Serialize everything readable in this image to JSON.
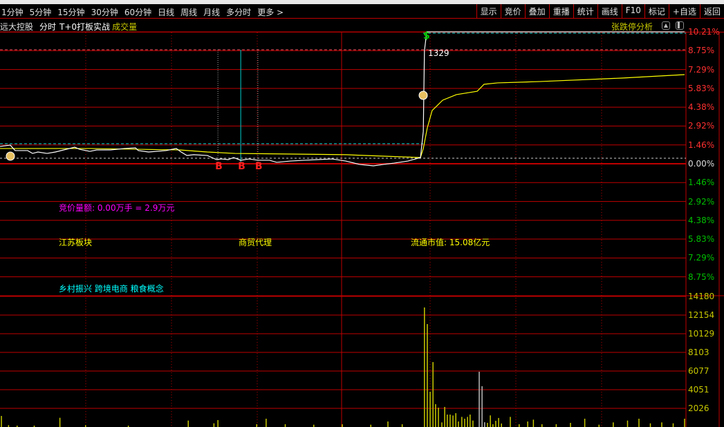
{
  "toolbar": {
    "periods": [
      "1分钟",
      "5分钟",
      "15分钟",
      "30分钟",
      "60分钟",
      "日线",
      "周线",
      "月线",
      "多分时",
      "更多 >"
    ],
    "buttons": [
      "显示",
      "竞价",
      "叠加",
      "重播",
      "统计",
      "画线",
      "F10",
      "标记",
      "+自选",
      "返回"
    ]
  },
  "subbar": {
    "stock_name": "远大控股",
    "mode": "分时",
    "strategy": "T+0打板实战",
    "indicator": "成交量",
    "analysis": "张跌停分析"
  },
  "info": {
    "auction": "竞价量额: 0.00万手 = 2.9万元",
    "region": "江苏板块",
    "industry": "商贸代理",
    "float_cap": "流通市值: 15.08亿元",
    "concepts": "乡村振兴 跨境电商 粮食概念"
  },
  "markers": {
    "buy_label": "B",
    "sell_symbol": "$",
    "spike_volume": "1329"
  },
  "colors": {
    "grid": "#c00000",
    "price": "#ffffff",
    "avg": "#ffff00",
    "up": "#ff3030",
    "down": "#00c000",
    "vol": "#c8c800"
  },
  "chart_data": {
    "type": "line",
    "price_axis_labels": [
      "10.21%",
      "8.75%",
      "7.29%",
      "5.83%",
      "4.38%",
      "2.92%",
      "1.46%",
      "0.00%",
      "1.46%",
      "2.92%",
      "4.38%",
      "5.83%",
      "7.29%",
      "8.75%"
    ],
    "price_axis_values": [
      10.21,
      8.75,
      7.29,
      5.83,
      4.38,
      2.92,
      1.46,
      0,
      -1.46,
      -2.92,
      -4.38,
      -5.83,
      -7.29,
      -8.75
    ],
    "volume_axis_labels": [
      "14180",
      "12154",
      "10129",
      "8103",
      "6077",
      "4051",
      "2026"
    ],
    "volume_axis_values": [
      14180,
      12154,
      10129,
      8103,
      6077,
      4051,
      2026
    ],
    "x_range_minutes": [
      0,
      240
    ],
    "buy_minutes": [
      76.4,
      84.4,
      90.4
    ],
    "price_pct": [
      [
        0,
        1.34
      ],
      [
        3.6,
        1.44
      ],
      [
        5.3,
        1.02
      ],
      [
        9.7,
        1.02
      ],
      [
        11.4,
        0.8
      ],
      [
        13.3,
        0.91
      ],
      [
        16.5,
        0.8
      ],
      [
        19.4,
        0.91
      ],
      [
        26.2,
        1.28
      ],
      [
        27.9,
        1.12
      ],
      [
        31.5,
        0.96
      ],
      [
        33.9,
        1.07
      ],
      [
        38.8,
        1.07
      ],
      [
        43.6,
        1.18
      ],
      [
        47.5,
        1.23
      ],
      [
        48.5,
        1.02
      ],
      [
        52.1,
        0.91
      ],
      [
        58.2,
        1.02
      ],
      [
        61.8,
        1.18
      ],
      [
        63.5,
        0.91
      ],
      [
        65.5,
        0.64
      ],
      [
        67.9,
        0.7
      ],
      [
        72.7,
        0.64
      ],
      [
        75.9,
        0.32
      ],
      [
        77.6,
        0.37
      ],
      [
        80,
        0.32
      ],
      [
        81.9,
        0.48
      ],
      [
        84.4,
        0.27
      ],
      [
        87.3,
        0.37
      ],
      [
        90.4,
        0.27
      ],
      [
        94.5,
        0.27
      ],
      [
        97,
        0.11
      ],
      [
        101.8,
        0.21
      ],
      [
        106.7,
        0.27
      ],
      [
        111.5,
        0.32
      ],
      [
        116.4,
        0.37
      ],
      [
        121.2,
        0.21
      ],
      [
        126,
        -0.05
      ],
      [
        130.9,
        -0.16
      ],
      [
        134.5,
        -0.05
      ],
      [
        138.2,
        0.05
      ],
      [
        143,
        0.21
      ],
      [
        147.4,
        0.48
      ],
      [
        148.4,
        2.51
      ],
      [
        148.8,
        8.75
      ],
      [
        149.6,
        10.21
      ],
      [
        240,
        10.21
      ]
    ],
    "avg_pct": [
      [
        0,
        1.18
      ],
      [
        31.5,
        1.18
      ],
      [
        63,
        1.07
      ],
      [
        72.7,
        0.91
      ],
      [
        82.4,
        0.8
      ],
      [
        121.2,
        0.7
      ],
      [
        147.4,
        0.48
      ],
      [
        148.4,
        1.18
      ],
      [
        149.8,
        2.78
      ],
      [
        151.5,
        4.12
      ],
      [
        155.2,
        4.92
      ],
      [
        160,
        5.35
      ],
      [
        167.3,
        5.61
      ],
      [
        169.7,
        6.15
      ],
      [
        174.5,
        6.26
      ],
      [
        189,
        6.36
      ],
      [
        218,
        6.63
      ],
      [
        240,
        6.9
      ]
    ],
    "volume": [
      [
        0.5,
        1200
      ],
      [
        3,
        200
      ],
      [
        6,
        150
      ],
      [
        12,
        150
      ],
      [
        21,
        1000
      ],
      [
        30,
        200
      ],
      [
        45,
        150
      ],
      [
        66,
        700
      ],
      [
        75,
        400
      ],
      [
        76.4,
        750
      ],
      [
        90,
        300
      ],
      [
        93.3,
        900
      ],
      [
        100,
        300
      ],
      [
        110,
        250
      ],
      [
        120,
        300
      ],
      [
        130,
        250
      ],
      [
        136,
        600
      ],
      [
        141,
        300
      ],
      [
        148.8,
        12980
      ],
      [
        149.8,
        11180
      ],
      [
        150.8,
        3830
      ],
      [
        151.8,
        7050
      ],
      [
        152.7,
        2480
      ],
      [
        153.7,
        2100
      ],
      [
        154.9,
        500
      ],
      [
        155.9,
        2180
      ],
      [
        156.8,
        1350
      ],
      [
        157.8,
        1350
      ],
      [
        158.8,
        1250
      ],
      [
        159.8,
        1500
      ],
      [
        160.7,
        600
      ],
      [
        161.9,
        1100
      ],
      [
        162.9,
        900
      ],
      [
        163.9,
        1100
      ],
      [
        164.8,
        1350
      ],
      [
        165.8,
        700
      ],
      [
        168,
        6000
      ],
      [
        169,
        4430
      ],
      [
        169.9,
        520
      ],
      [
        170.9,
        450
      ],
      [
        171.9,
        1260
      ],
      [
        172.8,
        300
      ],
      [
        173.8,
        670
      ],
      [
        174.8,
        980
      ],
      [
        175.8,
        380
      ],
      [
        178.9,
        1100
      ],
      [
        182,
        300
      ],
      [
        185,
        600
      ],
      [
        187,
        800
      ],
      [
        190,
        300
      ],
      [
        195,
        300
      ],
      [
        200,
        450
      ],
      [
        205,
        900
      ],
      [
        210,
        250
      ],
      [
        215,
        500
      ],
      [
        220,
        700
      ],
      [
        224,
        900
      ],
      [
        228,
        400
      ],
      [
        232,
        500
      ],
      [
        236,
        400
      ],
      [
        240,
        900
      ]
    ]
  }
}
